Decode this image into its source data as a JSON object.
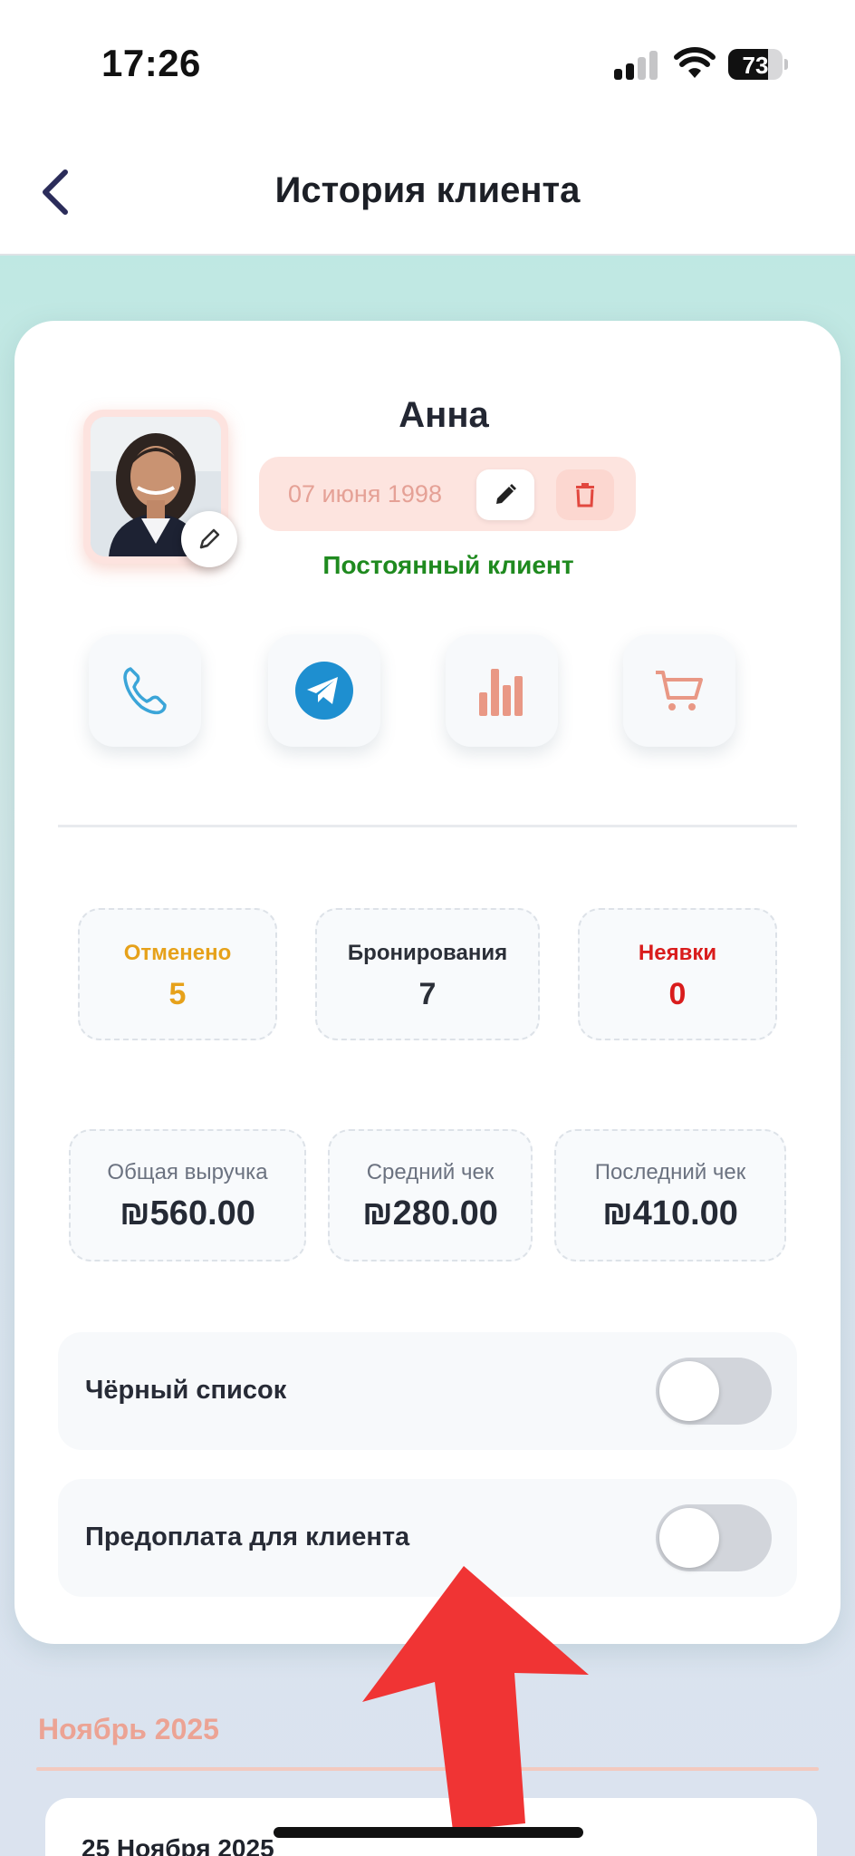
{
  "status_bar": {
    "time": "17:26",
    "battery": "73",
    "battery_level": 0.73
  },
  "navbar": {
    "title": "История клиента",
    "back_icon": "chevron-left-icon"
  },
  "client": {
    "name": "Анна",
    "birth_date": "07 июня 1998",
    "status": "Постоянный клиент"
  },
  "actions": [
    {
      "icon": "phone-icon"
    },
    {
      "icon": "telegram-icon"
    },
    {
      "icon": "bar-chart-icon"
    },
    {
      "icon": "cart-icon"
    }
  ],
  "stats": [
    {
      "label": "Отменено",
      "value": "5",
      "color": "#e6a11a"
    },
    {
      "label": "Бронирования",
      "value": "7",
      "color": "#2b2f38"
    },
    {
      "label": "Неявки",
      "value": "0",
      "color": "#d91c1c"
    }
  ],
  "money": [
    {
      "label": "Общая выручка",
      "value": "₪560.00"
    },
    {
      "label": "Средний чек",
      "value": "₪280.00"
    },
    {
      "label": "Последний чек",
      "value": "₪410.00"
    }
  ],
  "toggles": [
    {
      "label": "Чёрный список",
      "on": false
    },
    {
      "label": "Предоплата для клиента",
      "on": false
    }
  ],
  "history": {
    "month": "Ноябрь 2025",
    "entries": [
      {
        "date": "25 Ноября 2025"
      }
    ]
  },
  "colors": {
    "accent": "#eca394",
    "status_green": "#1f8a1f",
    "arrow_red": "#f03434"
  }
}
